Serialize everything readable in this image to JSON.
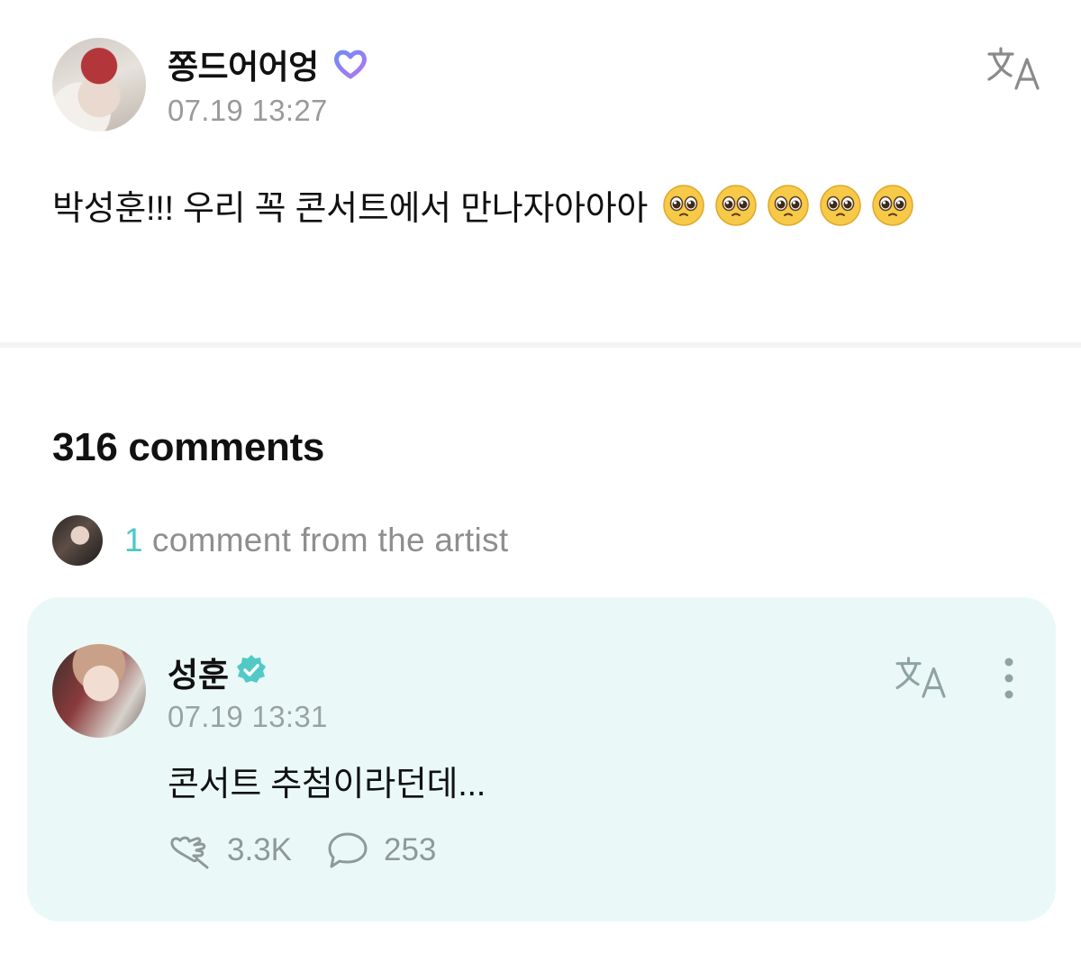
{
  "post": {
    "author": "쫑드어어엉",
    "timestamp": "07.19 13:27",
    "text": "박성훈!!! 우리 꼭 콘서트에서 만나자아아아",
    "emojis": [
      "pleading-face-emoji",
      "pleading-face-emoji",
      "pleading-face-emoji",
      "pleading-face-emoji",
      "pleading-face-emoji"
    ]
  },
  "comments": {
    "count_label": "316 comments",
    "artist_summary": {
      "count": "1",
      "label": "comment from the artist"
    },
    "artist_comment": {
      "author": "성훈",
      "timestamp": "07.19 13:31",
      "text": "콘서트 추첨이라던데...",
      "likes": "3.3K",
      "replies": "253"
    }
  },
  "icons": {
    "translate": "translate-icon",
    "more": "more-vertical-icon",
    "like": "heart-hand-icon",
    "reply": "speech-bubble-icon",
    "verified": "verified-badge-icon",
    "fan_badge": "heart-badge-icon"
  },
  "colors": {
    "accent_teal": "#4fc6c6",
    "card_background": "#eaf9f8",
    "muted_text": "#9a9a9a",
    "heart_gradient_start": "#6f8cf5",
    "heart_gradient_end": "#b176f0"
  }
}
